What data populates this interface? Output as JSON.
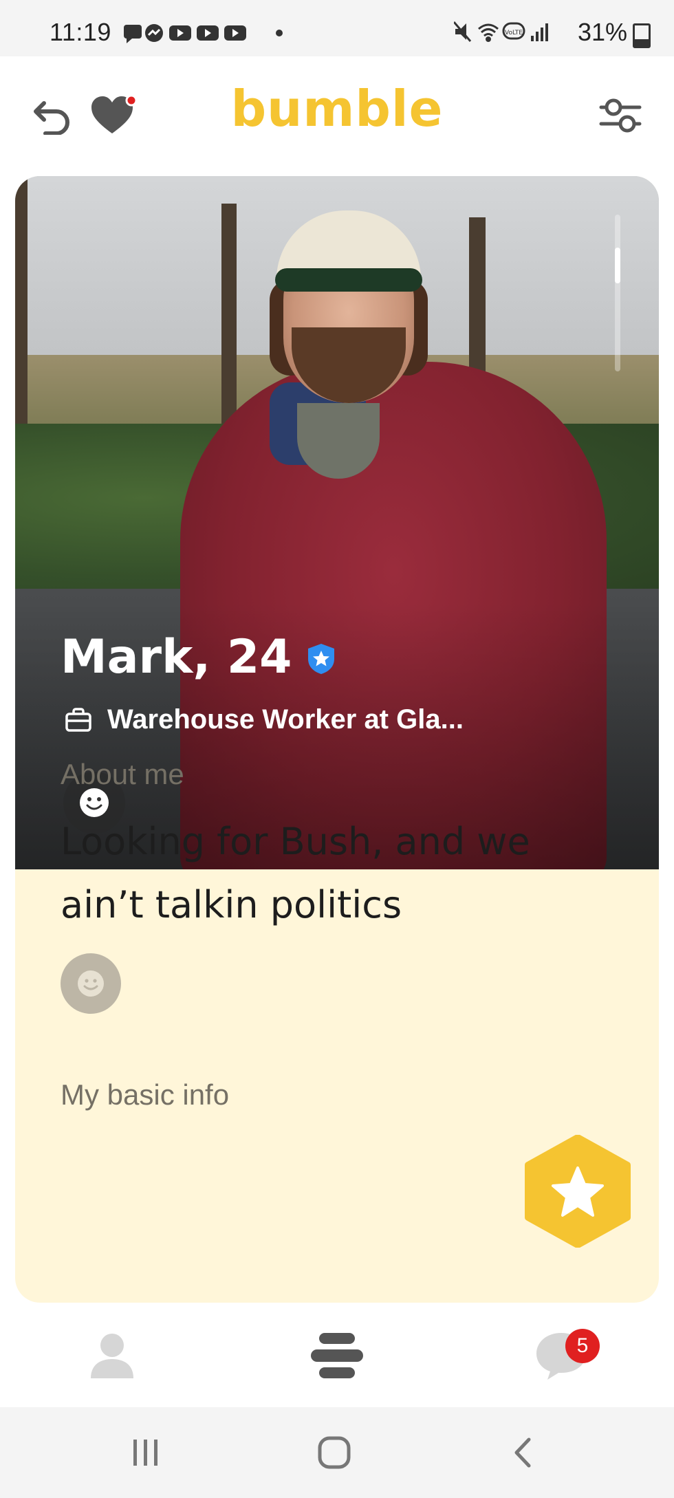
{
  "status_bar": {
    "time": "11:19",
    "battery_text": "31%",
    "icons": [
      "chat-icon",
      "messenger-icon",
      "youtube-icon",
      "youtube-icon",
      "youtube-icon",
      "dot-icon",
      "mute-icon",
      "wifi-icon",
      "volte-icon",
      "signal-icon",
      "battery-icon"
    ]
  },
  "header": {
    "logo": "bumble",
    "back_icon": "undo-icon",
    "likes_icon": "heart-icon",
    "filter_icon": "filter-sliders-icon"
  },
  "profile": {
    "name_age": "Mark, 24",
    "verified_icon": "verified-badge-icon",
    "job": "Warehouse Worker at Gla...",
    "job_icon": "briefcase-icon",
    "mood_icon": "smiley-icon"
  },
  "about": {
    "label": "About me",
    "text": "Looking for Bush, and we ain’t talkin politics",
    "mood_icon": "smiley-icon"
  },
  "basic_info": {
    "label": "My basic info"
  },
  "superswipe": {
    "icon": "star-icon",
    "color": "#f5c431"
  },
  "bottom_nav": {
    "profile_icon": "person-icon",
    "swipe_icon": "swipe-stack-icon",
    "chat_icon": "chat-bubble-icon",
    "chat_badge": "5"
  },
  "system_nav": {
    "recents_icon": "recents-icon",
    "home_icon": "home-icon",
    "back_icon": "back-chevron-icon"
  },
  "colors": {
    "brand": "#f5c431",
    "card_background": "#fff6d9",
    "verified": "#2f8ef0",
    "badge": "#e02020"
  }
}
